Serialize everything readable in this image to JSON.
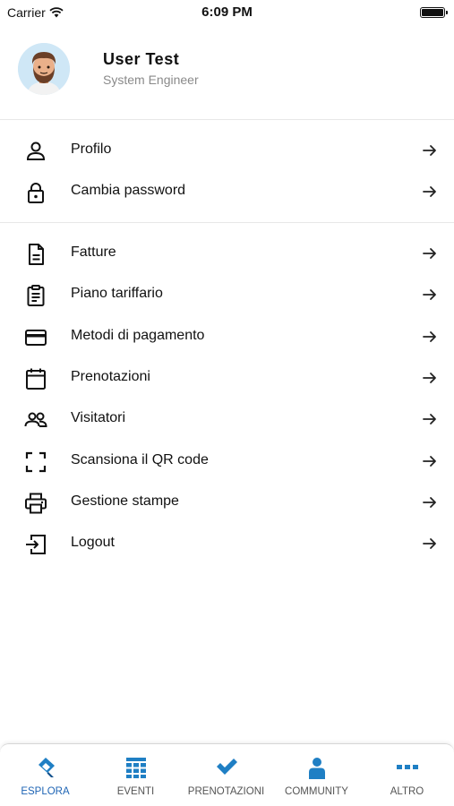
{
  "status_bar": {
    "carrier": "Carrier",
    "time": "6:09 PM"
  },
  "profile": {
    "name": "User Test",
    "role": "System Engineer"
  },
  "account_menu": [
    {
      "label": "Profilo",
      "icon": "user-icon"
    },
    {
      "label": "Cambia password",
      "icon": "lock-icon"
    }
  ],
  "main_menu": [
    {
      "label": "Fatture",
      "icon": "document-icon"
    },
    {
      "label": "Piano tariffario",
      "icon": "clipboard-icon"
    },
    {
      "label": "Metodi di pagamento",
      "icon": "credit-card-icon"
    },
    {
      "label": "Prenotazioni",
      "icon": "calendar-icon"
    },
    {
      "label": "Visitatori",
      "icon": "people-icon"
    },
    {
      "label": "Scansiona il QR code",
      "icon": "scan-icon"
    },
    {
      "label": "Gestione stampe",
      "icon": "printer-icon"
    },
    {
      "label": "Logout",
      "icon": "logout-icon"
    }
  ],
  "tab_bar": [
    {
      "label": "ESPLORA",
      "icon": "explore-icon",
      "active": true
    },
    {
      "label": "EVENTI",
      "icon": "events-grid-icon",
      "active": false
    },
    {
      "label": "PRENOTAZIONI",
      "icon": "checkmark-icon",
      "active": false
    },
    {
      "label": "COMMUNITY",
      "icon": "person-icon",
      "active": false
    },
    {
      "label": "ALTRO",
      "icon": "more-icon",
      "active": false
    }
  ],
  "colors": {
    "accent": "#1e64b4",
    "tab_icon_blue": "#1f7fc4",
    "divider": "#e8e8e8",
    "secondary_text": "#8a8a8a"
  }
}
